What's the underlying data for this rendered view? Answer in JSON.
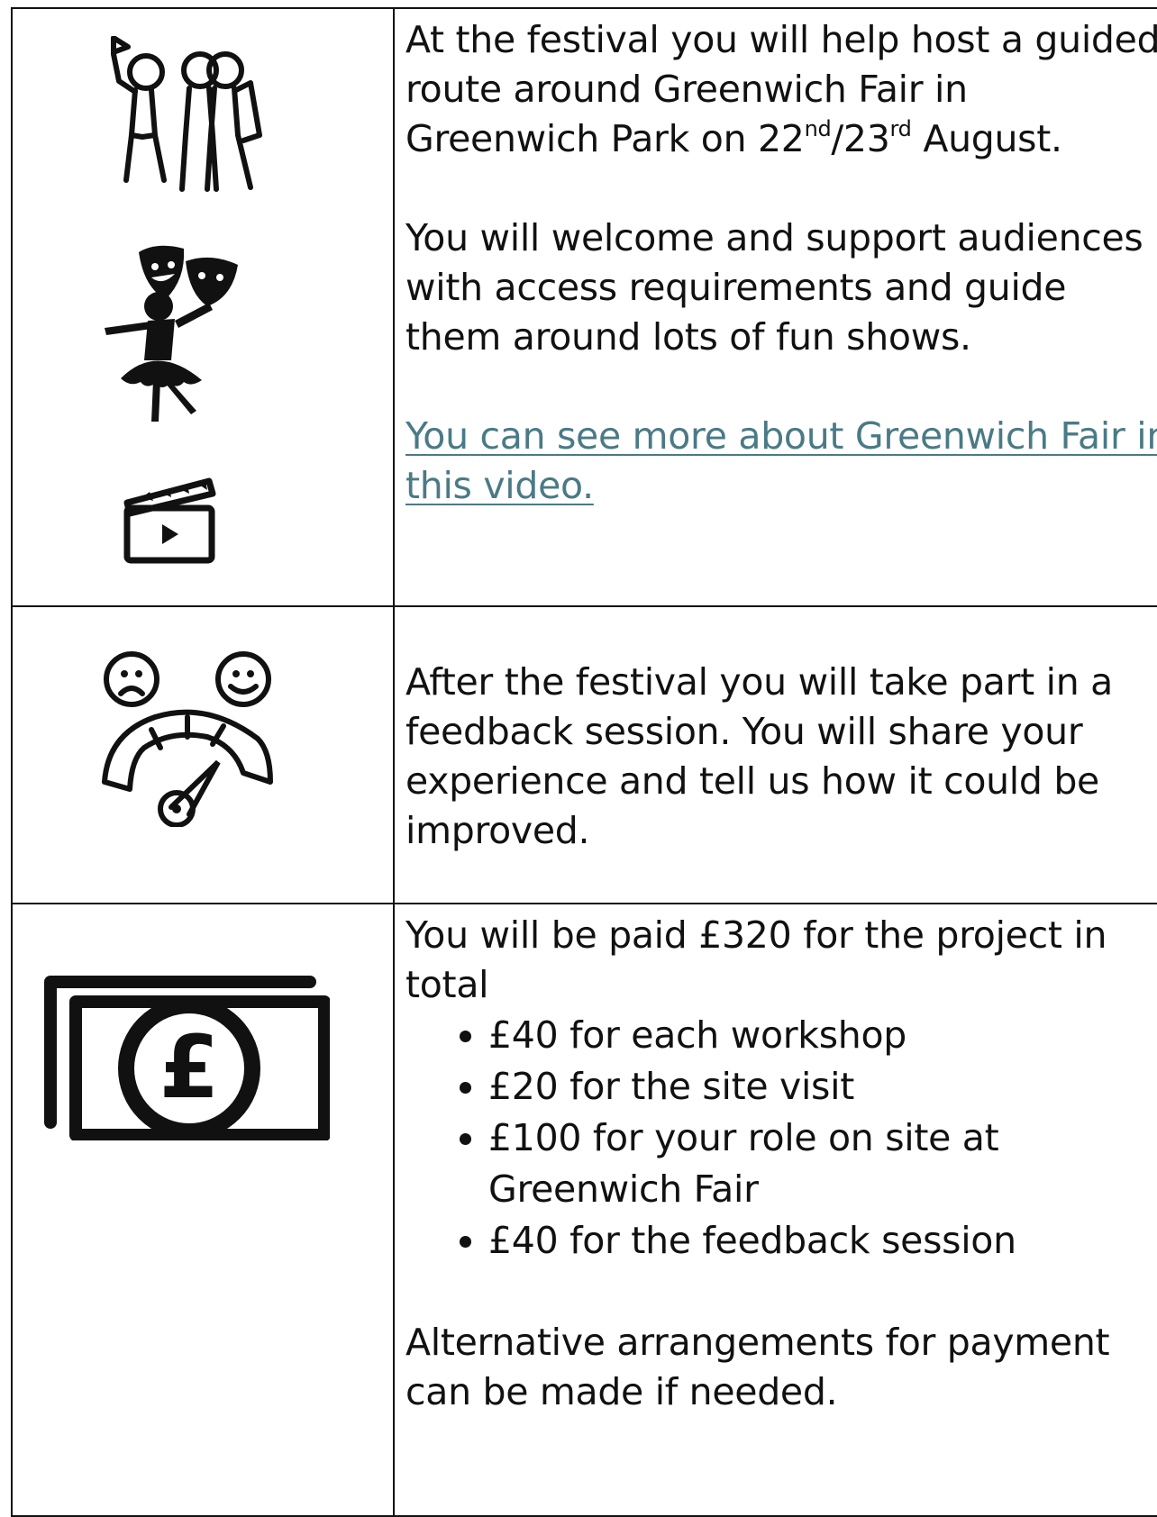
{
  "rows": [
    {
      "icons": [
        "guided-walk-icon",
        "theatre-masks-dancer-icon",
        "video-clapperboard-icon"
      ],
      "paragraph1": {
        "text_before": "At the festival you will help host a guided route around Greenwich Fair in Greenwich Park on 22",
        "sup1": "nd",
        "text_mid": "/23",
        "sup2": "rd",
        "text_after": " August."
      },
      "paragraph2": "You will welcome and support audiences with access requirements and guide them around lots of fun shows.",
      "link_text": "You can see more about Greenwich Fair in this video."
    },
    {
      "icons": [
        "feedback-meter-icon"
      ],
      "paragraph": "After the festival you will take part in a feedback session. You will share your experience and tell us how it could be improved."
    },
    {
      "icons": [
        "money-pound-icon"
      ],
      "intro": "You will be paid £320 for the project in total",
      "items": [
        "£40 for each workshop",
        "£20 for the site visit",
        "£100 for your role on site at Greenwich Fair",
        "£40 for the feedback session"
      ],
      "closing": "Alternative arrangements for payment can be made if needed."
    }
  ],
  "colors": {
    "link": "#4a7a86",
    "border": "#111111",
    "text": "#111111"
  }
}
